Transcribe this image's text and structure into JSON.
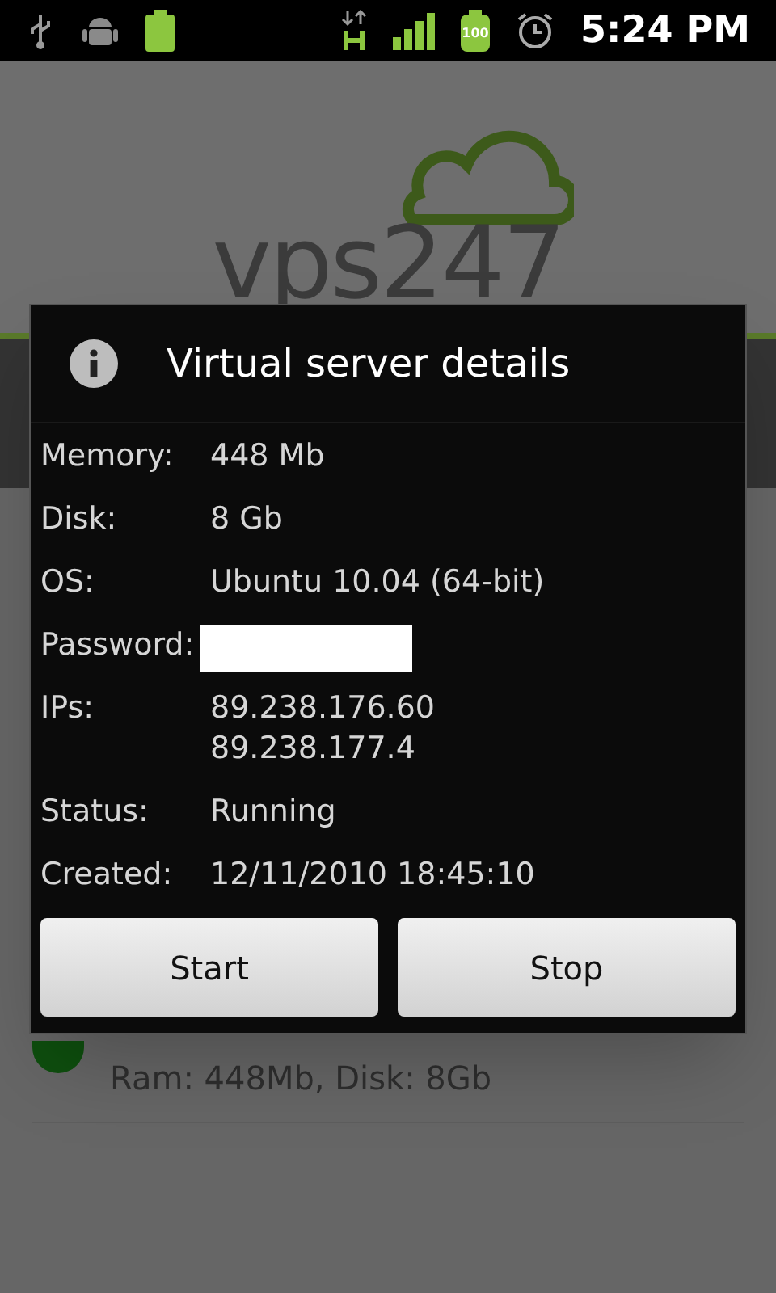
{
  "status_bar": {
    "battery_label": "100",
    "time": "5:24 PM"
  },
  "app": {
    "logo": "vps247",
    "servers": [
      {
        "details": "Ram: 448Mb, Disk: 8Gb"
      }
    ]
  },
  "dialog": {
    "title": "Virtual server details",
    "fields": [
      {
        "label": "Memory:",
        "kind": "text",
        "values": [
          "448 Mb"
        ]
      },
      {
        "label": "Disk:",
        "kind": "text",
        "values": [
          "8 Gb"
        ]
      },
      {
        "label": "OS:",
        "kind": "text",
        "values": [
          "Ubuntu 10.04 (64-bit)"
        ]
      },
      {
        "label": "Password:",
        "kind": "redacted"
      },
      {
        "label": "IPs:",
        "kind": "text",
        "values": [
          "89.238.176.60",
          "89.238.177.4"
        ]
      },
      {
        "label": "Status:",
        "kind": "text",
        "values": [
          "Running"
        ]
      },
      {
        "label": "Created:",
        "kind": "text",
        "values": [
          "12/11/2010 18:45:10"
        ]
      }
    ],
    "buttons": [
      "Start",
      "Stop"
    ]
  }
}
